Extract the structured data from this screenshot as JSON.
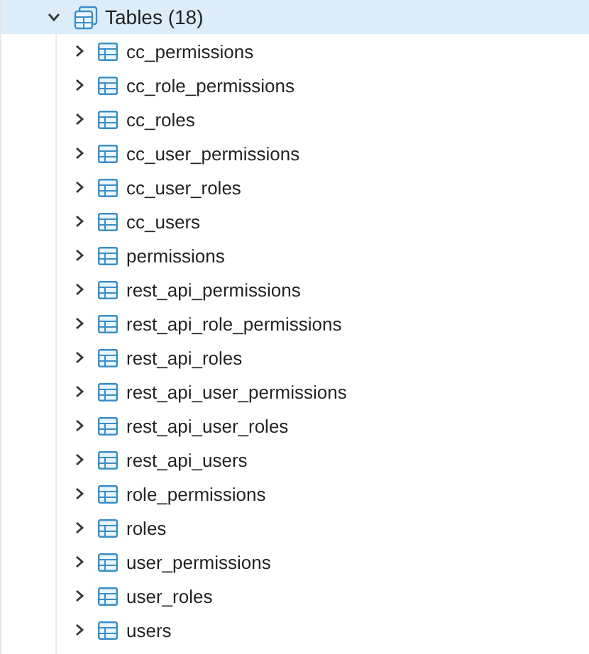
{
  "tree": {
    "label": "Tables (18)",
    "expanded": true,
    "selected": true,
    "children": [
      {
        "label": "cc_permissions",
        "expanded": false
      },
      {
        "label": "cc_role_permissions",
        "expanded": false
      },
      {
        "label": "cc_roles",
        "expanded": false
      },
      {
        "label": "cc_user_permissions",
        "expanded": false
      },
      {
        "label": "cc_user_roles",
        "expanded": false
      },
      {
        "label": "cc_users",
        "expanded": false
      },
      {
        "label": "permissions",
        "expanded": false
      },
      {
        "label": "rest_api_permissions",
        "expanded": false
      },
      {
        "label": "rest_api_role_permissions",
        "expanded": false
      },
      {
        "label": "rest_api_roles",
        "expanded": false
      },
      {
        "label": "rest_api_user_permissions",
        "expanded": false
      },
      {
        "label": "rest_api_user_roles",
        "expanded": false
      },
      {
        "label": "rest_api_users",
        "expanded": false
      },
      {
        "label": "role_permissions",
        "expanded": false
      },
      {
        "label": "roles",
        "expanded": false
      },
      {
        "label": "user_permissions",
        "expanded": false
      },
      {
        "label": "user_roles",
        "expanded": false
      },
      {
        "label": "users",
        "expanded": false
      }
    ]
  }
}
